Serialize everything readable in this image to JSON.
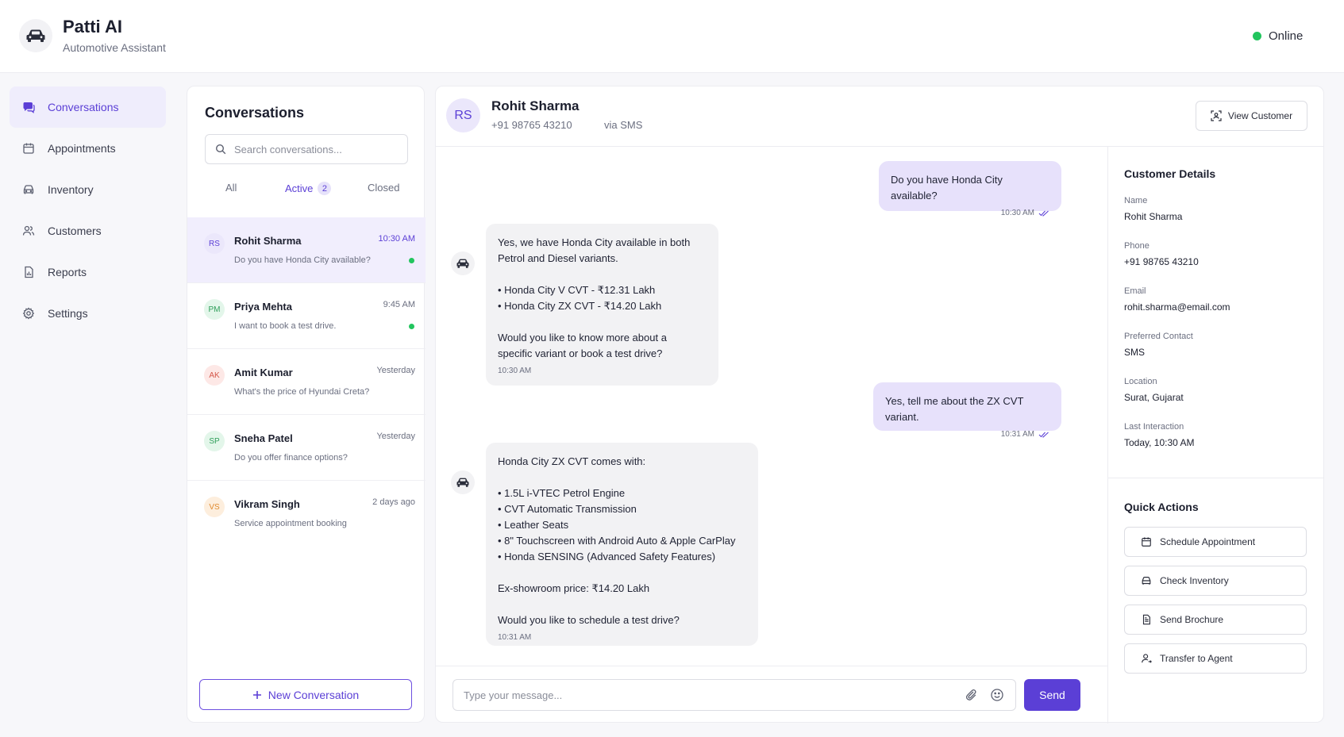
{
  "app": {
    "title": "Patti AI",
    "subtitle": "Automotive Assistant",
    "status": "Online"
  },
  "nav": {
    "items": [
      {
        "label": "Conversations",
        "icon": "chat-icon",
        "active": true
      },
      {
        "label": "Appointments",
        "icon": "calendar-icon"
      },
      {
        "label": "Inventory",
        "icon": "car-icon"
      },
      {
        "label": "Customers",
        "icon": "users-icon"
      },
      {
        "label": "Reports",
        "icon": "report-icon"
      },
      {
        "label": "Settings",
        "icon": "gear-icon"
      }
    ]
  },
  "conversations": {
    "title": "Conversations",
    "search_placeholder": "Search conversations...",
    "tabs": {
      "all": "All",
      "active": "Active",
      "active_count": "2",
      "closed": "Closed"
    },
    "items": [
      {
        "initials": "RS",
        "name": "Rohit Sharma",
        "preview": "Do you have Honda City available?",
        "time": "10:30 AM",
        "unread": true,
        "avatar_bg": "#ebe7fb",
        "avatar_fg": "#5b3fd6"
      },
      {
        "initials": "PM",
        "name": "Priya Mehta",
        "preview": "I want to book a test drive.",
        "time": "9:45 AM",
        "unread": true,
        "avatar_bg": "#e3f6ea",
        "avatar_fg": "#2f9e5a"
      },
      {
        "initials": "AK",
        "name": "Amit Kumar",
        "preview": "What's the price of Hyundai Creta?",
        "time": "Yesterday",
        "unread": false,
        "avatar_bg": "#fde8e6",
        "avatar_fg": "#d4574a"
      },
      {
        "initials": "SP",
        "name": "Sneha Patel",
        "preview": "Do you offer finance options?",
        "time": "Yesterday",
        "unread": false,
        "avatar_bg": "#e3f6ea",
        "avatar_fg": "#2f9e5a"
      },
      {
        "initials": "VS",
        "name": "Vikram Singh",
        "preview": "Service appointment booking",
        "time": "2 days ago",
        "unread": false,
        "avatar_bg": "#fdeedd",
        "avatar_fg": "#e08a2e"
      }
    ],
    "new_label": "New Conversation"
  },
  "chat": {
    "initials": "RS",
    "name": "Rohit Sharma",
    "phone": "+91 98765 43210",
    "channel": "via SMS",
    "view_customer_label": "View Customer",
    "messages": [
      {
        "dir": "out",
        "text": "Do you have Honda City available?",
        "time": "10:30 AM"
      },
      {
        "dir": "in",
        "text": "Yes, we have Honda City available in both\nPetrol and Diesel variants.\n\n• Honda City V CVT - ₹12.31 Lakh\n• Honda City ZX CVT - ₹14.20 Lakh\n\nWould you like to know more about a\nspecific variant or book a test drive?",
        "time": "10:30 AM"
      },
      {
        "dir": "out",
        "text": "Yes, tell me about the ZX CVT variant.",
        "time": "10:31 AM"
      },
      {
        "dir": "in",
        "text": "Honda City ZX CVT comes with:\n\n• 1.5L i-VTEC Petrol Engine\n• CVT Automatic Transmission\n• Leather Seats\n• 8\" Touchscreen with Android Auto & Apple CarPlay\n• Honda SENSING (Advanced Safety Features)\n\nEx-showroom price: ₹14.20 Lakh\n\nWould you like to schedule a test drive?",
        "time": "10:31 AM"
      }
    ],
    "input_placeholder": "Type your message...",
    "send_label": "Send"
  },
  "customer": {
    "title": "Customer Details",
    "fields": [
      {
        "label": "Name",
        "value": "Rohit Sharma"
      },
      {
        "label": "Phone",
        "value": "+91 98765 43210"
      },
      {
        "label": "Email",
        "value": "rohit.sharma@email.com"
      },
      {
        "label": "Preferred Contact",
        "value": "SMS"
      },
      {
        "label": "Location",
        "value": "Surat, Gujarat"
      },
      {
        "label": "Last Interaction",
        "value": "Today, 10:30 AM"
      }
    ]
  },
  "quick_actions": {
    "title": "Quick Actions",
    "items": [
      {
        "label": "Schedule Appointment",
        "icon": "calendar-icon"
      },
      {
        "label": "Check Inventory",
        "icon": "car-icon"
      },
      {
        "label": "Send Brochure",
        "icon": "document-icon"
      },
      {
        "label": "Transfer to Agent",
        "icon": "user-icon"
      }
    ]
  },
  "colors": {
    "accent": "#5b3fd6",
    "online": "#22c55e",
    "out_bubble": "#e7e1fb",
    "in_bubble": "#f2f2f4"
  }
}
